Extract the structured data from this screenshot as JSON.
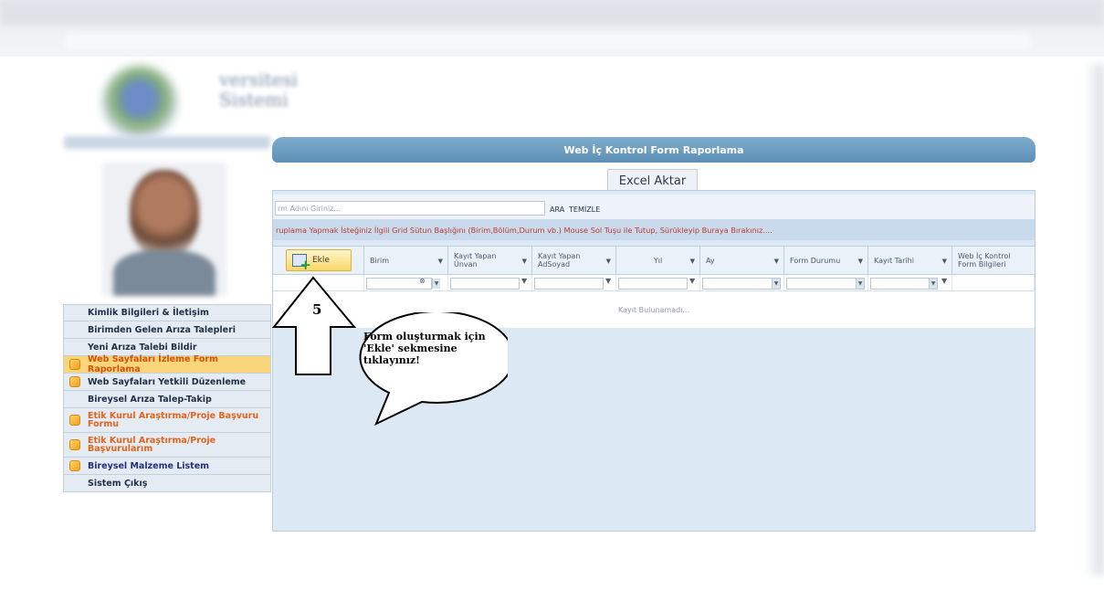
{
  "browser": {
    "url_fragment": ""
  },
  "header": {
    "line1": "versitesi",
    "line2": "Sistemi"
  },
  "sidebar": {
    "items": [
      {
        "label": "Kimlik Bilgileri & İletişim",
        "style": "plain",
        "icon": false
      },
      {
        "label": "Birimden Gelen Arıza Talepleri",
        "style": "plain",
        "icon": false
      },
      {
        "label": "Yeni Arıza Talebi Bildir",
        "style": "plain",
        "icon": false
      },
      {
        "label": "Web Sayfaları İzleme Form Raporlama",
        "style": "active",
        "icon": true
      },
      {
        "label": "Web Sayfaları Yetkili Düzenleme",
        "style": "plain",
        "icon": true
      },
      {
        "label": "Bireysel Arıza Talep-Takip",
        "style": "plain",
        "icon": false
      },
      {
        "label": "Etik Kurul Araştırma/Proje Başvuru Formu",
        "style": "orange",
        "icon": true
      },
      {
        "label": "Etik Kurul Araştırma/Proje Başvurularım",
        "style": "orange",
        "icon": true
      },
      {
        "label": "Bireysel Malzeme Listem",
        "style": "navy",
        "icon": true
      },
      {
        "label": "Sistem Çıkış",
        "style": "plain",
        "icon": false
      }
    ]
  },
  "main": {
    "title": "Web İç Kontrol Form Raporlama",
    "excel_button": "Excel Aktar",
    "search": {
      "placeholder": "rm Adını Giriniz...",
      "search_button": "ARA",
      "clear_button": "TEMİZLE"
    },
    "group_hint": "ruplama Yapmak İsteğiniz İlgili Grid Sütun Başlığını (Birim,Bölüm,Durum vb.) Mouse Sol Tuşu ile Tutup, Sürükleyip Buraya Bırakınız....",
    "add_button": "Ekle",
    "columns": {
      "birim": "Birim",
      "unvan": "Kayıt Yapan Ünvan",
      "adsoyad": "Kayıt Yapan AdSoyad",
      "yil": "Yıl",
      "ay": "Ay",
      "form_durumu": "Form Durumu",
      "kayit_tarihi": "Kayıt Tarihi",
      "web_ic_kontrol": "Web İç Kontrol Form Bilgileri"
    },
    "empty_text": "Kayıt Bulunamadı..."
  },
  "annotation": {
    "step_number": "5",
    "bubble_lines": [
      "Form oluşturmak için",
      "'Ekle' sekmesine",
      "tıklayınız!"
    ]
  },
  "colors": {
    "title_bar": "#6b9cc0",
    "panel_bg": "#dce9f5",
    "active_menu_bg": "#fbd57a",
    "orange_text": "#e2641b",
    "hint_red": "#c0392b"
  }
}
